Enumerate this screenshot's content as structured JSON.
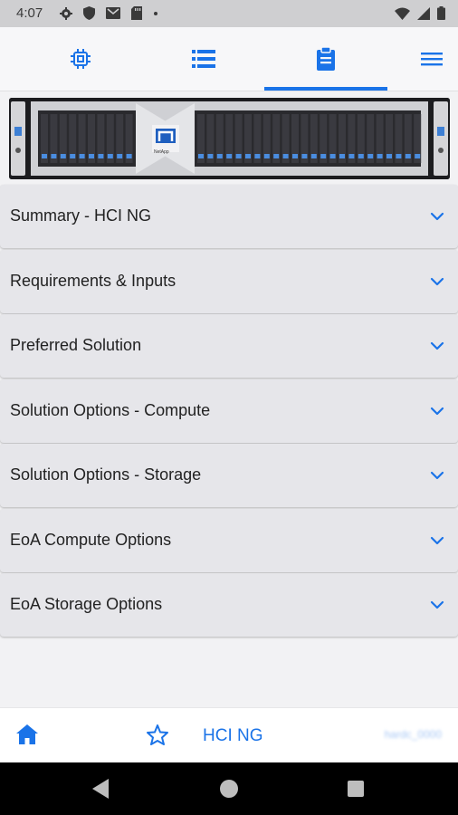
{
  "status_bar": {
    "time": "4:07",
    "icons": [
      "settings-icon",
      "shield-icon",
      "gmail-icon",
      "sdcard-icon",
      "dot-icon"
    ],
    "right_icons": [
      "wifi-icon",
      "signal-icon",
      "battery-icon"
    ]
  },
  "top_tabs": [
    {
      "icon": "cpu-icon",
      "selected": false
    },
    {
      "icon": "list-icon",
      "selected": false
    },
    {
      "icon": "clipboard-icon",
      "selected": true
    }
  ],
  "banner": {
    "logo_text": "NetApp"
  },
  "accordion": {
    "items": [
      {
        "label": "Summary - HCI NG"
      },
      {
        "label": "Requirements & Inputs"
      },
      {
        "label": "Preferred Solution"
      },
      {
        "label": "Solution Options - Compute"
      },
      {
        "label": "Solution Options - Storage"
      },
      {
        "label": "EoA Compute Options"
      },
      {
        "label": "EoA Storage Options"
      }
    ]
  },
  "bottom_nav": {
    "title": "HCI NG",
    "user": "hardc_0000"
  },
  "colors": {
    "accent": "#1a73e8",
    "item_bg": "#e6e6ea",
    "status_bar": "#cfcfd1"
  }
}
